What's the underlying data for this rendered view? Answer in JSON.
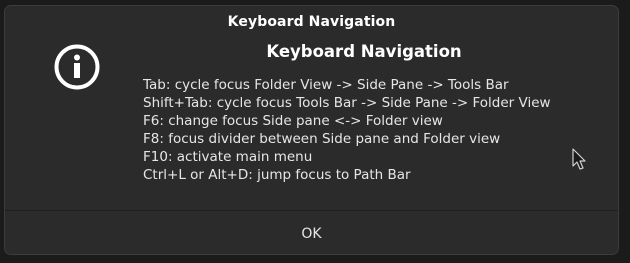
{
  "dialog": {
    "window_title": "Keyboard Navigation",
    "icon": "info-icon",
    "heading": "Keyboard Navigation",
    "lines": [
      "Tab: cycle focus Folder View -> Side Pane -> Tools Bar",
      "Shift+Tab: cycle focus Tools Bar -> Side Pane -> Folder View",
      "F6: change focus Side pane <-> Folder view",
      "F8: focus divider between Side pane and Folder view",
      "F10: activate main menu",
      "Ctrl+L or Alt+D: jump focus to Path Bar"
    ],
    "ok_label": "OK"
  },
  "colors": {
    "dialog_background": "#2b2b2b",
    "text": "#ffffff",
    "body_text": "#e6e6e6"
  }
}
